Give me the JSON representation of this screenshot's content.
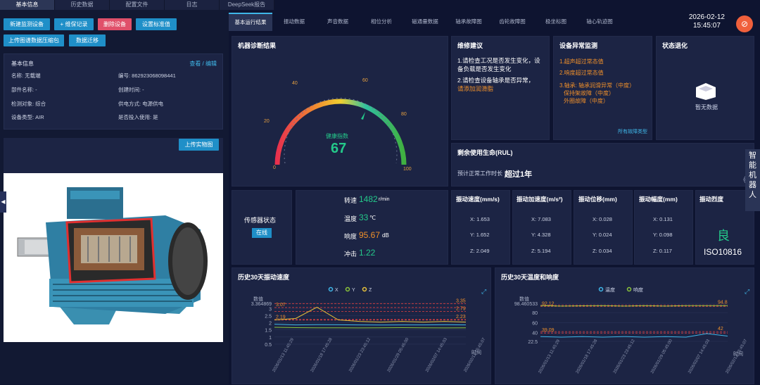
{
  "top_tabs": [
    "基本信息",
    "历史数据",
    "配置文件",
    "日志",
    "DeepSeek报告"
  ],
  "buttons": {
    "new_device": "新建监测设备",
    "maintenance": "+ 维保记录",
    "delete": "删除设备",
    "set_standard": "设置标准值",
    "upload_pkg": "上传图谱数据压缩包",
    "migrate": "数据迁移"
  },
  "basic_info": {
    "title": "基本信息",
    "link": "查看 / 编辑",
    "name": "名称: 无载端",
    "code": "编号: 862923068098441",
    "part": "部件名称: -",
    "created": "创建时间: -",
    "object": "检测对象: 综合",
    "power": "供电方式: 电源供电",
    "type": "设备类型: AIR",
    "in_use": "是否投入使用: 是"
  },
  "upload_photo": "上传实物图",
  "side_handle": "◀",
  "tabs": [
    "基本运行结果",
    "振动数据",
    "声音数据",
    "相位分析",
    "磁通量数据",
    "轴承故障图",
    "齿轮故障图",
    "极坐标图",
    "轴心轨迹图"
  ],
  "datetime": {
    "date": "2026-02-12",
    "time": "15:45:07"
  },
  "close_icon": "⊘",
  "diagnosis": {
    "title": "机器诊断结果",
    "label": "健康指数",
    "value": "67",
    "ticks": [
      "0",
      "20",
      "40",
      "60",
      "80",
      "100"
    ],
    "zones": [
      "报警\n严重",
      "预警\n注意",
      "警告\n关注",
      "良好",
      "正常"
    ]
  },
  "maintenance": {
    "title": "维修建议",
    "item1": "1.请检查工况是否发生变化，设备负载是否发生变化",
    "item2a": "2.请检查设备轴承是否异常，",
    "item2b": "请添加润滑脂"
  },
  "anomaly": {
    "title": "设备异常监测",
    "item1": "1.超声超过常态值",
    "item2": "2.响度超过常态值",
    "item3": "3.轴承: 轴承润滑异常（中度）",
    "item4": "保持架故障（中度）",
    "item5": "外圈故障（中度）",
    "link": "所有故障类型"
  },
  "state": {
    "title": "状态退化",
    "empty": "暂无数据"
  },
  "rul": {
    "title": "剩余使用生命(RUL)",
    "label": "预计正常工作时长",
    "value": "超过1年"
  },
  "sensor": {
    "title": "传感器状态",
    "status": "在线"
  },
  "metrics": {
    "speed_label": "转速",
    "speed": "1482",
    "speed_unit": "r/min",
    "temp_label": "温度",
    "temp": "33",
    "temp_unit": "℃",
    "loud_label": "响度",
    "loud": "95.67",
    "loud_unit": "dB",
    "impact_label": "冲击",
    "impact": "1.22"
  },
  "vibration": {
    "headers": [
      "振动速度(mm/s)",
      "振动加速度(m/s²)",
      "振动位移(mm)",
      "振动幅度(mm)",
      "振动烈度"
    ],
    "velocity": {
      "x": "X:  1.653",
      "y": "Y:  1.652",
      "z": "Z:  2.049"
    },
    "accel": {
      "x": "X:  7.083",
      "y": "Y:  4.328",
      "z": "Z:  5.194"
    },
    "disp": {
      "x": "X:  0.028",
      "y": "Y:  0.024",
      "z": "Z:  0.034"
    },
    "amp": {
      "x": "X:  0.131",
      "y": "Y:  0.098",
      "z": "Z:  0.117"
    },
    "grade": "良",
    "standard": "ISO10816"
  },
  "vright": {
    "text": "智能机器人",
    "arrow": "《"
  },
  "chart_data": [
    {
      "type": "line",
      "title": "历史30天振动速度",
      "ylabel": "数值",
      "xlabel": "时间",
      "legend": [
        "X",
        "Y",
        "Z"
      ],
      "ylim": [
        0,
        3.364869
      ],
      "yticks": [
        "3.364869",
        "3",
        "2.5",
        "2",
        "1.5",
        "1",
        "0.5"
      ],
      "x": [
        "2026/01/13\n11:45:29",
        "2026/01/18\n17:45:28",
        "2026/01/23\n23:45:12",
        "2026/01/29\n05:45:00",
        "2026/02/07\n14:45:03",
        "2026/02/12\n15:45:07"
      ],
      "threshold_labels": [
        "3.35",
        "2.79",
        "2.23",
        "3.07",
        "2.19"
      ],
      "series": [
        {
          "name": "X",
          "values": [
            1.9,
            1.85,
            1.87,
            1.86,
            1.85,
            1.84,
            1.85,
            1.85,
            1.86,
            1.85
          ]
        },
        {
          "name": "Y",
          "values": [
            1.68,
            1.66,
            1.65,
            1.65,
            1.64,
            1.65,
            1.66,
            1.65,
            1.64,
            1.65
          ]
        },
        {
          "name": "Z",
          "values": [
            2.2,
            2.3,
            3.1,
            2.2,
            2.1,
            2.05,
            2.1,
            2.05,
            2.1,
            2.05
          ]
        }
      ]
    },
    {
      "type": "line",
      "title": "历史30天温度和响度",
      "ylabel": "数值",
      "xlabel": "时间",
      "legend": [
        "温度",
        "响度"
      ],
      "ylim": [
        0,
        98.460533
      ],
      "yticks": [
        "98.460533",
        "80",
        "60",
        "40",
        "22.5"
      ],
      "x": [
        "2026/01/13\n11:45:29",
        "2026/01/18\n17:45:28",
        "2026/01/23\n23:45:12",
        "2026/01/29\n05:45:00",
        "2026/02/07\n14:45:03",
        "2026/02/12\n15:45:07"
      ],
      "threshold_labels": [
        "94.8",
        "92.12",
        "42",
        "39.09"
      ],
      "series": [
        {
          "name": "温度",
          "values": [
            32,
            31,
            32,
            31,
            32,
            31,
            32,
            31,
            38,
            33
          ]
        },
        {
          "name": "响度",
          "values": [
            94,
            93,
            93.5,
            94,
            93,
            94,
            93,
            94,
            94,
            94
          ]
        }
      ]
    }
  ]
}
